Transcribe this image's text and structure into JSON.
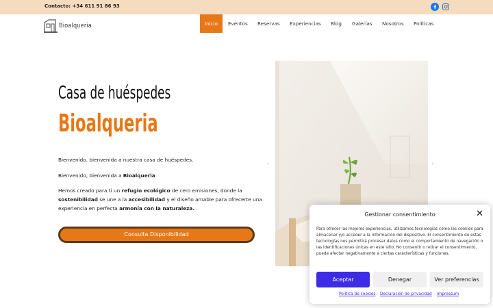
{
  "topbar": {
    "contact": "Contacto: +34 611 91 86 93",
    "social": [
      {
        "name": "facebook-icon",
        "color": "#1877f2"
      },
      {
        "name": "instagram-icon",
        "color": "#3d6aa8"
      }
    ]
  },
  "header": {
    "logo_text": "Bioalqueria",
    "nav": [
      {
        "label": "Inicio",
        "active": true
      },
      {
        "label": "Eventos",
        "active": false
      },
      {
        "label": "Reservas",
        "active": false
      },
      {
        "label": "Experiencias",
        "active": false
      },
      {
        "label": "Blog",
        "active": false
      },
      {
        "label": "Galerías",
        "active": false
      },
      {
        "label": "Nosotros",
        "active": false
      },
      {
        "label": "Políticas",
        "active": false
      }
    ]
  },
  "hero": {
    "title": "Casa de huéspedes",
    "brand": "Bioalqueria",
    "p1": "Bienvenido, bienvenida a nuestra casa de huéspedes.",
    "p2_prefix": "Bienvenido, bienvenida a ",
    "p2_bold": "Bioalqueria",
    "p3_a": "Hemos creado para ti un ",
    "p3_b": "refugio ecológico",
    "p3_c": " de cero emisiones, donde la ",
    "p3_d": "sostenibilidad",
    "p3_e": " se une a la ",
    "p3_f": "accesibilidad",
    "p3_g": " y el diseño amable para ofrecerte una experiencia en perfecta ",
    "p3_h": "armonía con la naturaleza.",
    "cta": "Consulta Disponibilidad"
  },
  "colors": {
    "accent": "#e77817",
    "topbar_bg": "#f6dcbf",
    "consent_primary": "#3d2be8"
  },
  "consent": {
    "title": "Gestionar consentimiento",
    "body": "Para ofrecer las mejores experiencias, utilizamos tecnologías como las cookies para almacenar y/o acceder a la información del dispositivo. El consentimiento de estas tecnologías nos permitirá procesar datos como el comportamiento de navegación o las identificaciones únicas en este sitio. No consentir o retirar el consentimiento, puede afectar negativamente a ciertas características y funciones.",
    "accept": "Aceptar",
    "deny": "Denegar",
    "preferences": "Ver preferencias",
    "links": [
      "Política de cookies",
      "Declaración de privacidad",
      "Impressum"
    ]
  }
}
